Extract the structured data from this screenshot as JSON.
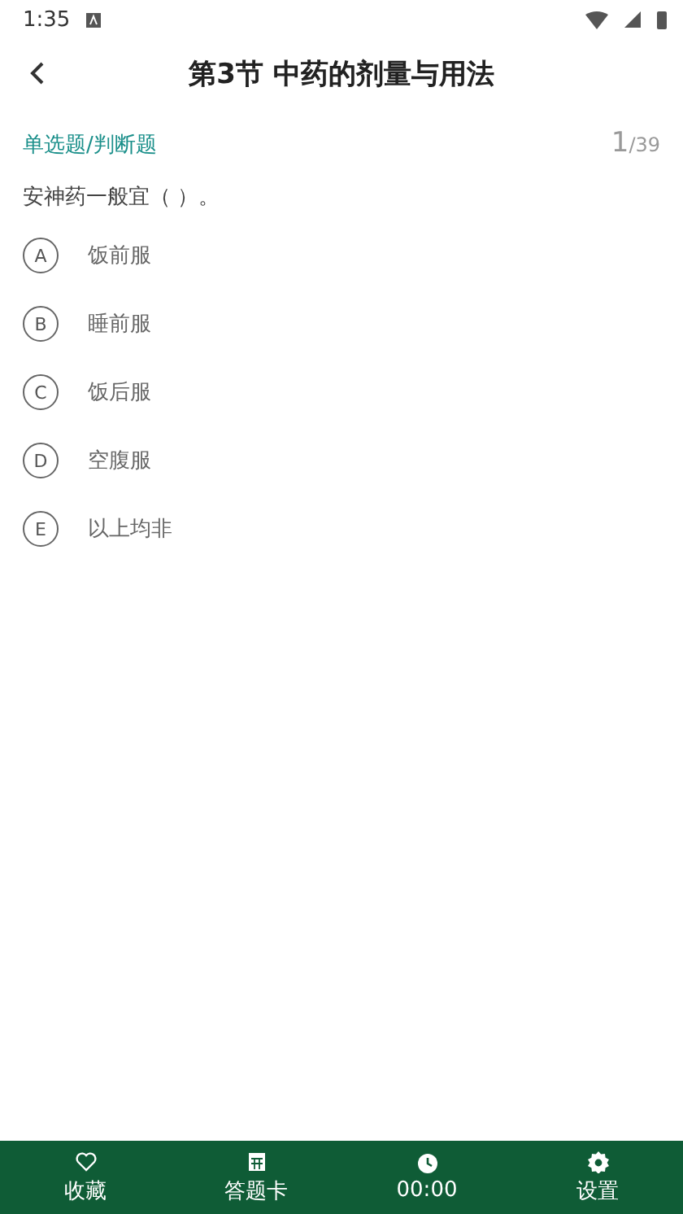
{
  "status_bar": {
    "time": "1:35"
  },
  "header": {
    "title": "第3节 中药的剂量与用法"
  },
  "question": {
    "type_label": "单选题/判断题",
    "current": "1",
    "total": "/39",
    "text": "安神药一般宜（ ）。",
    "options": [
      {
        "letter": "A",
        "text": "饭前服"
      },
      {
        "letter": "B",
        "text": "睡前服"
      },
      {
        "letter": "C",
        "text": "饭后服"
      },
      {
        "letter": "D",
        "text": "空腹服"
      },
      {
        "letter": "E",
        "text": "以上均非"
      }
    ]
  },
  "bottom_bar": [
    {
      "kind": "favorite",
      "label": "收藏"
    },
    {
      "kind": "card",
      "label": "答题卡"
    },
    {
      "kind": "timer",
      "label": "00:00"
    },
    {
      "kind": "settings",
      "label": "设置"
    }
  ]
}
